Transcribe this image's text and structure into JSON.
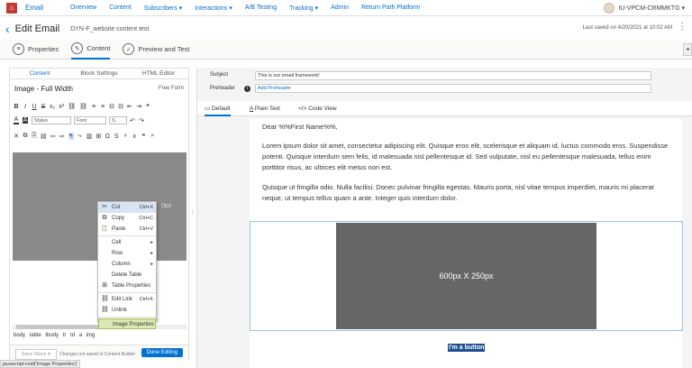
{
  "nav": {
    "app": "Email",
    "items": [
      "Overview",
      "Content",
      "Subscribers ▾",
      "Interactions ▾",
      "A/B Testing",
      "Tracking ▾",
      "Admin",
      "Return Path Platform"
    ],
    "user": "IU-VPCM-CRMMKTG ▾"
  },
  "header": {
    "back": "‹",
    "title": "Edit Email",
    "subtitle": "DYN-F_website content test",
    "saved": "Last saved on 4/20/2021 at 10:02 AM",
    "more": "⋮"
  },
  "steps": [
    {
      "label": "Properties",
      "icon": "≡"
    },
    {
      "label": "Content",
      "icon": "✎"
    },
    {
      "label": "Preview and Test",
      "icon": "✓"
    }
  ],
  "panel": {
    "tabs": [
      "Content",
      "Block Settings",
      "HTML Editor"
    ],
    "title": "Image - Full Width",
    "mode": "Free Form",
    "row1": [
      "B",
      "I",
      "U",
      "S",
      "x₂",
      "x²",
      "⛓",
      "⛓",
      "≡",
      "≡",
      "⊟",
      "⊟",
      "⇤",
      "⇥",
      "❝"
    ],
    "row2": [
      "A",
      "A",
      "Styles",
      "Font",
      "S..",
      "↶",
      "↷"
    ],
    "row3": [
      "✕",
      "⧉",
      "⎘",
      "▤",
      "⇦",
      "⇨",
      "↰",
      "⤷",
      "▥",
      "⊞",
      "Ω",
      "S",
      "⁸",
      "x",
      "❝",
      "⌕"
    ],
    "ghost": "0px",
    "crumbs": "body table tbody tr td a img",
    "save_block": "Save Block ▾",
    "not_saved": "Changes not saved in Content Builder",
    "done": "Done Editing"
  },
  "menu": [
    {
      "label": "Cut",
      "key": "Ctrl+X",
      "icon": "✂"
    },
    {
      "label": "Copy",
      "key": "Ctrl+C",
      "icon": "⧉"
    },
    {
      "label": "Paste",
      "key": "Ctrl+V",
      "icon": "📋"
    },
    {
      "label": "Cell",
      "key": "▸",
      "icon": ""
    },
    {
      "label": "Row",
      "key": "▸",
      "icon": ""
    },
    {
      "label": "Column",
      "key": "▸",
      "icon": ""
    },
    {
      "label": "Delete Table",
      "key": "",
      "icon": ""
    },
    {
      "label": "Table Properties",
      "key": "",
      "icon": "⊞"
    },
    {
      "label": "Edit Link",
      "key": "Ctrl+K",
      "icon": "⛓"
    },
    {
      "label": "Unlink",
      "key": "",
      "icon": "⛓"
    },
    {
      "label": "Image Properties",
      "key": "",
      "icon": ""
    }
  ],
  "fields": {
    "subject_label": "Subject",
    "subject": "This is our email framework!",
    "preheader_label": "Preheader",
    "preheader": "Add Preheader"
  },
  "views": [
    "Default",
    "Plain Text",
    "Code View"
  ],
  "email": {
    "greeting": "Dear %%First Name%%,",
    "p1": "Lorem ipsum dolor sit amet, consectetur adipiscing elit. Quisque eros elit, scelerisque et aliquam id, luctus commodo eros. Suspendisse potenti. Quisque interdum sem felis, id malesuada nisl pellentesque id. Sed vulputate, nisl eu pellentesque malesuada, tellus enim porttitor risus, ac ultrices elit metus non est.",
    "p2": "Quisque ut fringilla odio. Nulla facilisi. Donec pulvinar fringilla egestas. Mauris porta, nisl vitae tempus imperdiet, mauris mi placerat neque, ut tempus tellus quam a ante. Integer quis interdum dolor.",
    "placeholder": "600px X 250px",
    "button": "I'm a button"
  },
  "status": "javascript:void('Image Properties')",
  "colors": {
    "accent": "#0070d2",
    "highlight": "#dbe7b4"
  }
}
